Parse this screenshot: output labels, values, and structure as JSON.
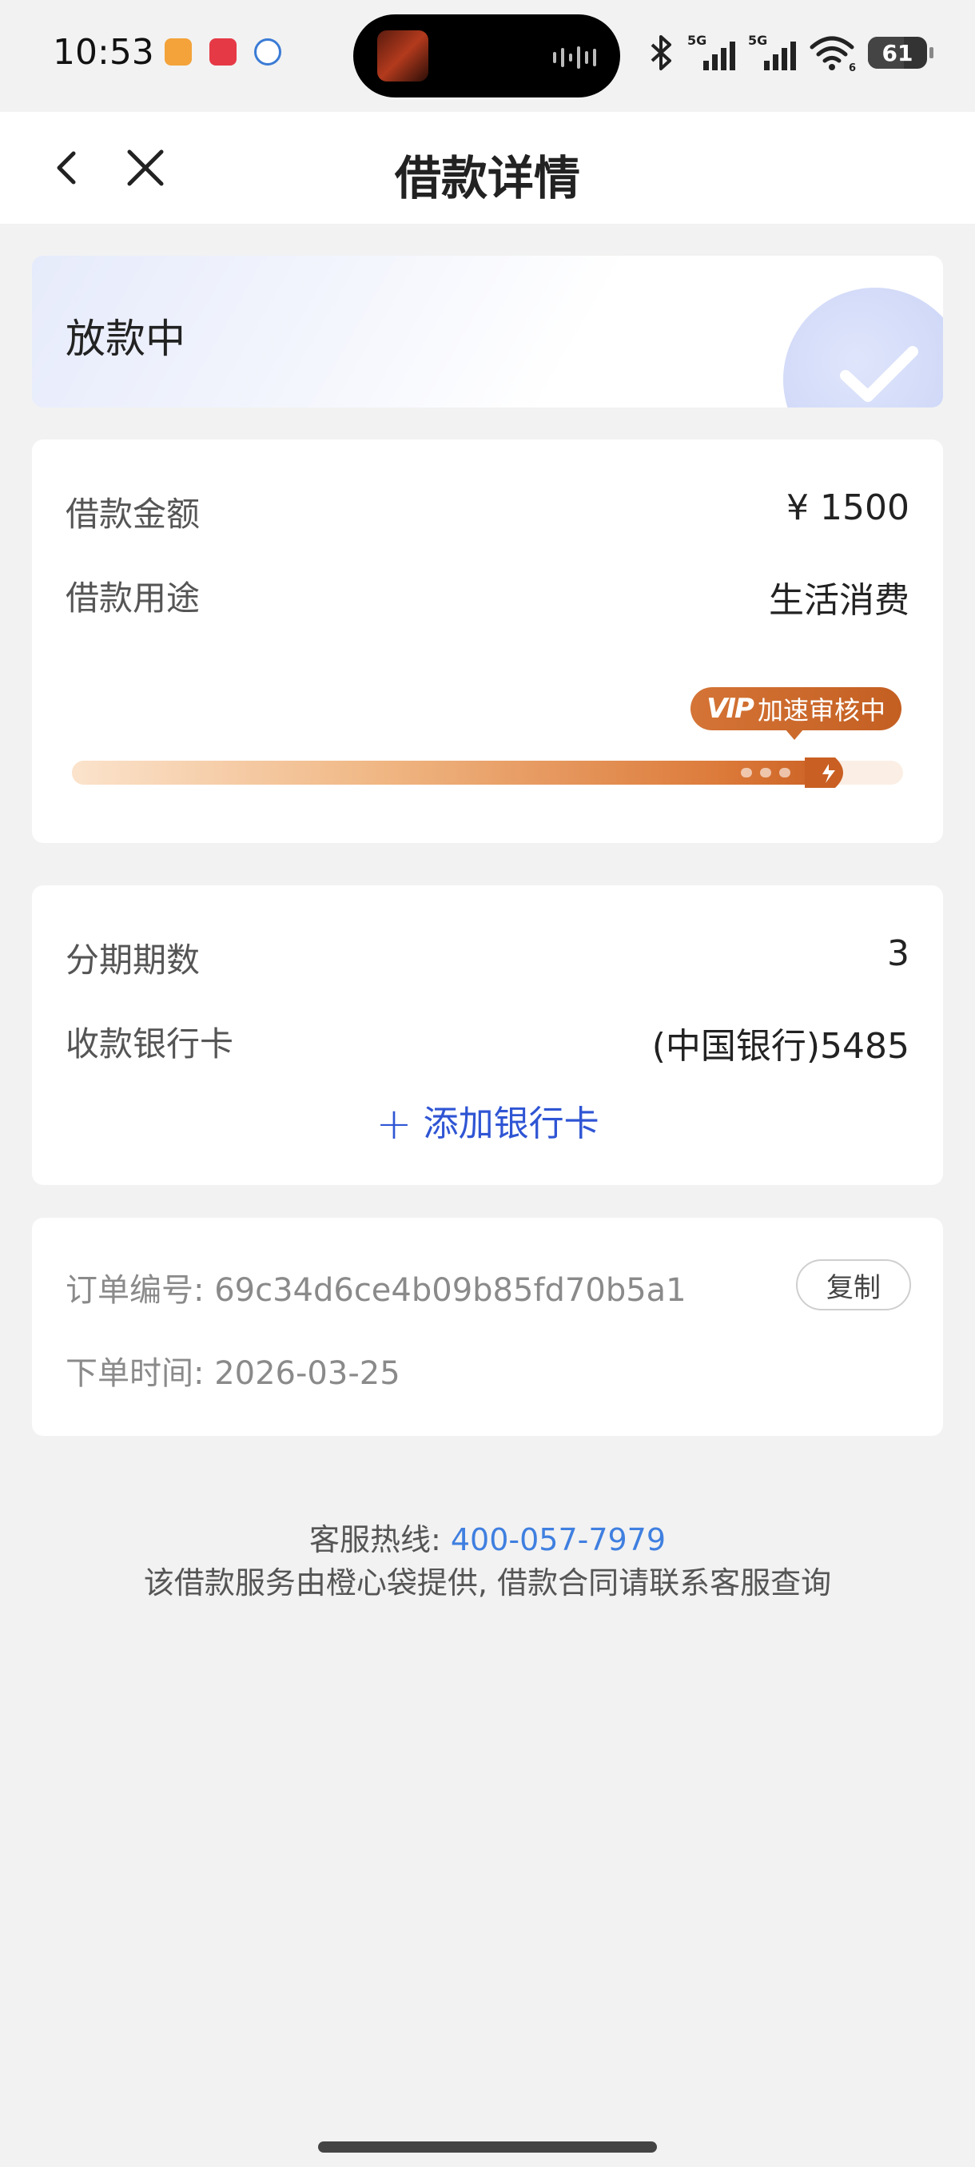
{
  "status_bar": {
    "time": "10:53",
    "signal_1_label": "5G",
    "signal_2_label": "5G",
    "wifi_label": "6",
    "battery": "61",
    "battery_level_percent": 61
  },
  "header": {
    "title": "借款详情"
  },
  "status_card": {
    "status": "放款中"
  },
  "loan": {
    "amount_label": "借款金额",
    "amount_value": "¥ 1500",
    "purpose_label": "借款用途",
    "purpose_value": "生活消费",
    "vip_mark": "VIP",
    "vip_text": "加速审核中",
    "progress_fraction": 0.92
  },
  "details": {
    "installments_label": "分期期数",
    "installments_value": "3",
    "bank_label": "收款银行卡",
    "bank_value": "(中国银行)5485",
    "add_card": "添加银行卡"
  },
  "order": {
    "number_line": "订单编号: 69c34d6ce4b09b85fd70b5a1",
    "copy_label": "复制",
    "time_line": "下单时间: 2026-03-25"
  },
  "footer": {
    "hotline_label": "客服热线:",
    "hotline_number": "400-057-7979",
    "note": "该借款服务由橙心袋提供, 借款合同请联系客服查询"
  },
  "colors": {
    "accent_blue": "#2f55d4",
    "link_blue": "#3f7fe0",
    "progress_orange": "#c95f22",
    "background": "#f2f2f2"
  }
}
